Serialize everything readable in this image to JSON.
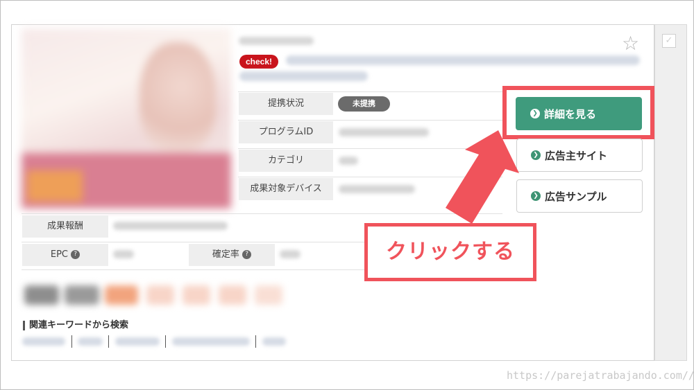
{
  "program": {
    "check_badge": "check!",
    "status_label": "提携状況",
    "status_badge": "未提携",
    "program_id_label": "プログラムID",
    "category_label": "カテゴリ",
    "device_label": "成果対象デバイス",
    "reward_label": "成果報酬",
    "epc_label": "EPC",
    "confirm_rate_label": "確定率",
    "help_glyph": "?"
  },
  "actions": {
    "detail_button": "詳細を見る",
    "advertiser_site_button": "広告主サイト",
    "ad_sample_button": "広告サンプル",
    "arrow_glyph": "❯"
  },
  "keywords": {
    "title": "関連キーワードから検索"
  },
  "annotation": {
    "callout_text": "クリックする",
    "highlight_color": "#f0535b"
  },
  "watermark": "https://parejatrabajando.com//",
  "icons": [
    "star-icon",
    "checkbox-icon",
    "help-icon",
    "arrow-right-icon"
  ]
}
